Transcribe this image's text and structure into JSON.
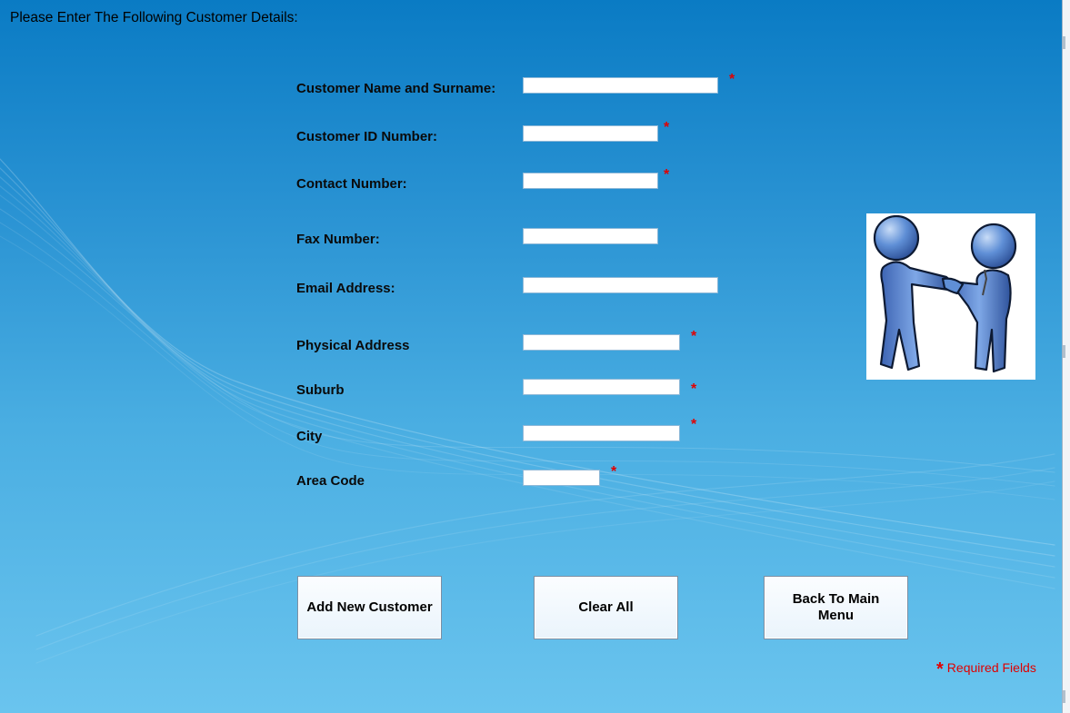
{
  "header": {
    "title": "Please Enter The Following Customer Details:"
  },
  "form": {
    "fields": [
      {
        "label": "Customer Name and Surname:",
        "value": "",
        "required": true
      },
      {
        "label": "Customer ID Number:",
        "value": "",
        "required": true
      },
      {
        "label": "Contact Number:",
        "value": "",
        "required": true
      },
      {
        "label": "Fax Number:",
        "value": "",
        "required": false
      },
      {
        "label": "Email Address:",
        "value": "",
        "required": false
      },
      {
        "label": "Physical Address",
        "value": "",
        "required": true
      },
      {
        "label": "Suburb",
        "value": "",
        "required": true
      },
      {
        "label": "City",
        "value": "",
        "required": true
      },
      {
        "label": "Area Code",
        "value": "",
        "required": true
      }
    ],
    "required_mark": "*"
  },
  "buttons": {
    "add": "Add New Customer",
    "clear": "Clear All",
    "back": "Back To Main Menu"
  },
  "footer": {
    "required_star": "*",
    "required_text": "Required Fields"
  },
  "illustration": {
    "icon": "two-figures-handshake-icon"
  },
  "colors": {
    "background_top": "#0a7bc4",
    "background_bottom": "#6ac4ee",
    "required": "#e00000",
    "figure": "#4a78c4"
  }
}
